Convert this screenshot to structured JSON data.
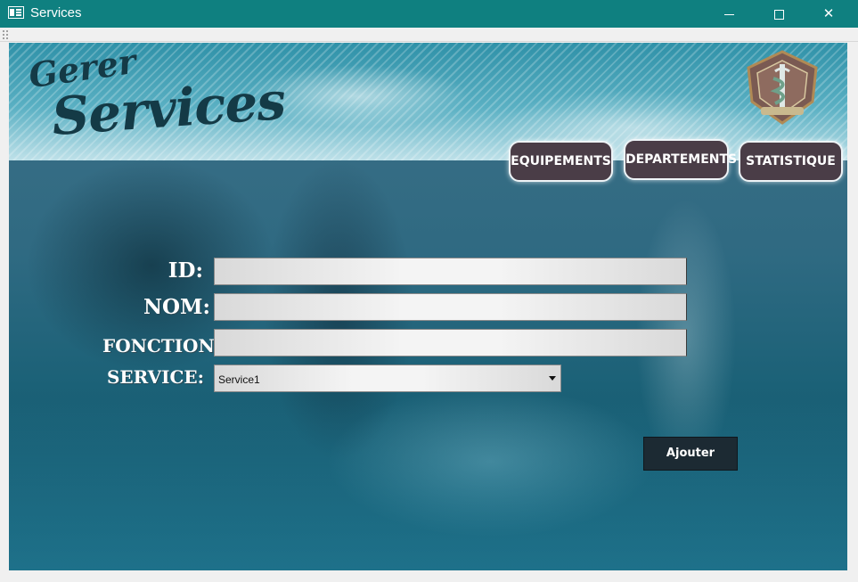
{
  "window": {
    "title": "Services",
    "icon": "app-window-icon",
    "controls": {
      "minimize": "minimize-icon",
      "maximize": "maximize-icon",
      "close_glyph": "✕"
    }
  },
  "header": {
    "logo_line1": "Gerer",
    "logo_line2": "Services",
    "emblem": "medical-emblem-icon",
    "nav": [
      {
        "label": "EQUIPEMENTS"
      },
      {
        "label": "DEPARTEMENTS"
      },
      {
        "label": "STATISTIQUE"
      }
    ]
  },
  "form": {
    "id_label": "ID:",
    "id_value": "",
    "nom_label": "NOM:",
    "nom_value": "",
    "fonction_label": "FONCTION:",
    "fonction_value": "",
    "service_label": "SERVICE:",
    "service_selected": "Service1",
    "submit_label": "Ajouter"
  },
  "colors": {
    "titlebar": "#0f8080",
    "nav_button": "#4a3d47",
    "submit_button": "#1c2a33",
    "logo_text": "#143a46"
  }
}
